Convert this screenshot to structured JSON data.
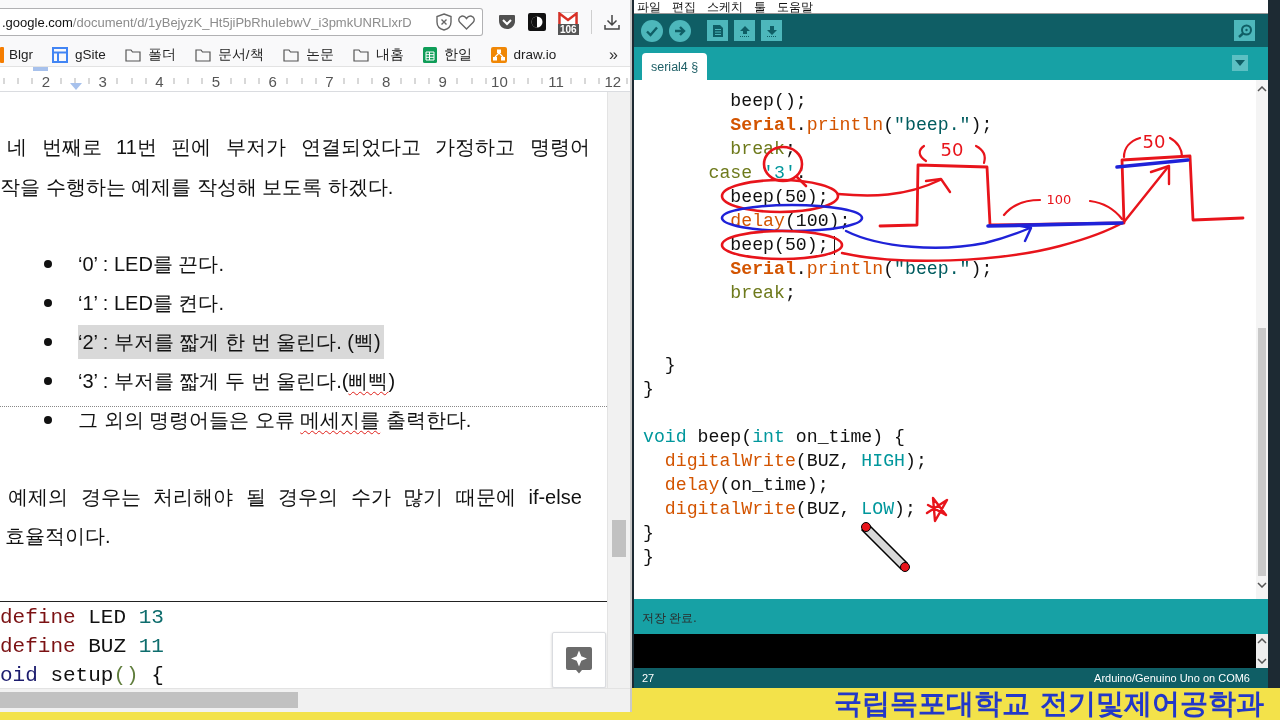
{
  "browser": {
    "url": {
      "host": ".google.com",
      "path": "/document/d/1yBejyzK_Ht5jiPbRhuIebwV_i3pmkUNRLlxrD"
    },
    "mail_count": "106",
    "bookmarks": [
      {
        "kind": "blog",
        "label": "Blgr"
      },
      {
        "kind": "site",
        "label": "gSite"
      },
      {
        "kind": "folder",
        "label": "폴더"
      },
      {
        "kind": "folder",
        "label": "문서/책"
      },
      {
        "kind": "folder",
        "label": "논문"
      },
      {
        "kind": "folder",
        "label": "내홈"
      },
      {
        "kind": "sheet",
        "label": "한일"
      },
      {
        "kind": "diagram",
        "label": "draw.io"
      }
    ],
    "bookmarks_more": "»"
  },
  "document": {
    "ruler": [
      "2",
      "3",
      "4",
      "5",
      "6",
      "7",
      "8",
      "9",
      "10",
      "11",
      "12"
    ],
    "intro_lines": [
      "네 번째로 11번 핀에 부저가 연결되었다고 가정하고 명령어",
      "작을 수행하는 예제를 작성해 보도록 하겠다."
    ],
    "bullets": [
      {
        "highlighted": false,
        "page_break_before": false,
        "segments": [
          {
            "text": "‘0’ : LED를 끈다.",
            "misspelled": false
          }
        ]
      },
      {
        "highlighted": false,
        "page_break_before": false,
        "segments": [
          {
            "text": "‘1’ : LED를 켠다.",
            "misspelled": false
          }
        ]
      },
      {
        "highlighted": true,
        "page_break_before": false,
        "segments": [
          {
            "text": "‘2’ : 부저를 짧게 한 번 울린다. (삑)",
            "misspelled": false
          }
        ]
      },
      {
        "highlighted": false,
        "page_break_before": false,
        "segments": [
          {
            "text": "‘3’ : 부저를 짧게 두 번 울린다.(",
            "misspelled": false
          },
          {
            "text": "삐삑",
            "misspelled": true
          },
          {
            "text": ")",
            "misspelled": false
          }
        ]
      },
      {
        "highlighted": false,
        "page_break_before": true,
        "segments": [
          {
            "text": "그 외의 명령어들은 오류 ",
            "misspelled": false
          },
          {
            "text": "메세지를",
            "misspelled": true
          },
          {
            "text": " 출력한다.",
            "misspelled": false
          }
        ]
      }
    ],
    "closing_lines": [
      "예제의 경우는 처리해야 될 경우의 수가 많기 때문에 if-else",
      "효율적이다."
    ],
    "code_lines": [
      [
        {
          "text": "define",
          "kind": "directive"
        },
        {
          "text": " LED ",
          "kind": "plain"
        },
        {
          "text": "13",
          "kind": "number"
        }
      ],
      [
        {
          "text": "define",
          "kind": "directive"
        },
        {
          "text": " BUZ ",
          "kind": "plain"
        },
        {
          "text": "11",
          "kind": "number"
        }
      ],
      [
        {
          "text": "oid",
          "kind": "type"
        },
        {
          "text": " setup",
          "kind": "plain"
        },
        {
          "text": "()",
          "kind": "paren"
        },
        {
          "text": " {",
          "kind": "plain"
        }
      ]
    ]
  },
  "ide": {
    "menu": [
      "파일",
      "편집",
      "스케치",
      "툴",
      "도움말"
    ],
    "tabs": [
      {
        "label": "serial4 §",
        "selected": true
      }
    ],
    "code_lines": [
      {
        "kind": "code",
        "tokens": [
          {
            "text": "        beep();",
            "kind": "plain"
          }
        ]
      },
      {
        "kind": "code",
        "tokens": [
          {
            "text": "        Serial",
            "kind": "class"
          },
          {
            "text": ".",
            "kind": "plain"
          },
          {
            "text": "println",
            "kind": "function"
          },
          {
            "text": "(",
            "kind": "plain"
          },
          {
            "text": "\"beep.\"",
            "kind": "string"
          },
          {
            "text": ");",
            "kind": "plain"
          }
        ]
      },
      {
        "kind": "code",
        "tokens": [
          {
            "text": "        break",
            "kind": "keyword"
          },
          {
            "text": ";",
            "kind": "plain"
          }
        ]
      },
      {
        "kind": "code",
        "tokens": [
          {
            "text": "      case",
            "kind": "keyword"
          },
          {
            "text": " '3'",
            "kind": "literal"
          },
          {
            "text": ":",
            "kind": "plain"
          }
        ]
      },
      {
        "kind": "code",
        "tokens": [
          {
            "text": "        beep(50);",
            "kind": "plain"
          }
        ]
      },
      {
        "kind": "code",
        "tokens": [
          {
            "text": "        delay",
            "kind": "function"
          },
          {
            "text": "(100);",
            "kind": "plain"
          }
        ]
      },
      {
        "kind": "code",
        "tokens": [
          {
            "text": "        beep(50);",
            "kind": "plain"
          },
          {
            "kind": "caret"
          }
        ]
      },
      {
        "kind": "code",
        "tokens": [
          {
            "text": "        Serial",
            "kind": "class"
          },
          {
            "text": ".",
            "kind": "plain"
          },
          {
            "text": "println",
            "kind": "function"
          },
          {
            "text": "(",
            "kind": "plain"
          },
          {
            "text": "\"beep.\"",
            "kind": "string"
          },
          {
            "text": ");",
            "kind": "plain"
          }
        ]
      },
      {
        "kind": "code",
        "tokens": [
          {
            "text": "        break",
            "kind": "keyword"
          },
          {
            "text": ";",
            "kind": "plain"
          }
        ]
      },
      {
        "kind": "blank"
      },
      {
        "kind": "blank"
      },
      {
        "kind": "code",
        "tokens": [
          {
            "text": "  }",
            "kind": "plain"
          }
        ]
      },
      {
        "kind": "code",
        "tokens": [
          {
            "text": "}",
            "kind": "plain"
          }
        ]
      },
      {
        "kind": "blank"
      },
      {
        "kind": "code",
        "tokens": [
          {
            "text": "void",
            "kind": "type"
          },
          {
            "text": " beep(",
            "kind": "plain"
          },
          {
            "text": "int",
            "kind": "type"
          },
          {
            "text": " on_time) {",
            "kind": "plain"
          }
        ]
      },
      {
        "kind": "code",
        "tokens": [
          {
            "text": "  digitalWrite",
            "kind": "function"
          },
          {
            "text": "(BUZ, ",
            "kind": "plain"
          },
          {
            "text": "HIGH",
            "kind": "literal"
          },
          {
            "text": ");",
            "kind": "plain"
          }
        ]
      },
      {
        "kind": "code",
        "tokens": [
          {
            "text": "  delay",
            "kind": "function"
          },
          {
            "text": "(on_time);",
            "kind": "plain"
          }
        ]
      },
      {
        "kind": "code",
        "tokens": [
          {
            "text": "  digitalWrite",
            "kind": "function"
          },
          {
            "text": "(BUZ, ",
            "kind": "plain"
          },
          {
            "text": "LOW",
            "kind": "literal"
          },
          {
            "text": ");",
            "kind": "plain"
          }
        ]
      },
      {
        "kind": "code",
        "tokens": [
          {
            "text": "}",
            "kind": "plain"
          }
        ]
      },
      {
        "kind": "code",
        "tokens": [
          {
            "text": "}",
            "kind": "plain"
          }
        ]
      }
    ],
    "message": "저장 완료.",
    "status": {
      "line": "27",
      "board": "Arduino/Genuino Uno on COM6"
    }
  },
  "annotations": {
    "ink": [
      {
        "kind": "ellipse",
        "color": "#e8141b"
      },
      {
        "kind": "ellipse",
        "color": "#e8141b"
      },
      {
        "kind": "ellipse",
        "color": "#1f22d8"
      },
      {
        "kind": "ellipse",
        "color": "#e8141b"
      },
      {
        "kind": "arrow",
        "color": "#e8141b"
      },
      {
        "kind": "arrow",
        "color": "#1f22d8"
      },
      {
        "kind": "arrow",
        "color": "#e8141b"
      },
      {
        "kind": "wave",
        "color": "#e8141b"
      },
      {
        "kind": "stroke",
        "color": "#1f22d8"
      },
      {
        "kind": "stroke",
        "color": "#1f22d8"
      },
      {
        "kind": "bracket",
        "color": "#e8141b"
      },
      {
        "kind": "bracket",
        "color": "#e8141b"
      },
      {
        "kind": "bracket",
        "color": "#e8141b"
      },
      {
        "kind": "star",
        "color": "#e8141b"
      }
    ],
    "labels": [
      {
        "text": "50"
      },
      {
        "text": "100"
      },
      {
        "text": "50"
      }
    ]
  },
  "banner": "국립목포대학교 전기및제어공학과"
}
